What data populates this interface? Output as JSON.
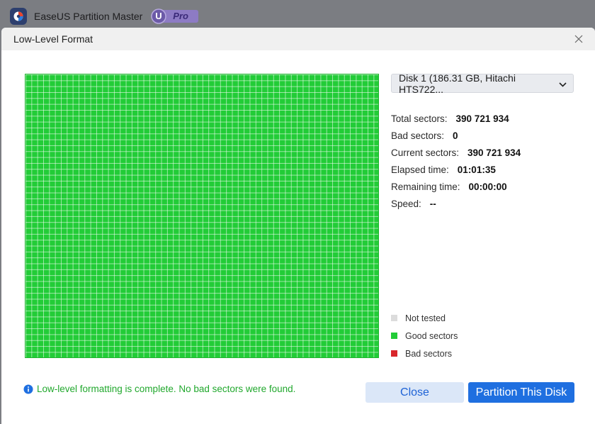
{
  "app": {
    "title": "EaseUS Partition Master",
    "badge_letter": "U",
    "badge_text": "Pro"
  },
  "dialog": {
    "title": "Low-Level Format"
  },
  "sector_grid": {
    "state": "good sectors",
    "fill_color": "#22cc37"
  },
  "disk_select": {
    "selected": "Disk 1 (186.31 GB, Hitachi HTS722..."
  },
  "stats": [
    {
      "label": "Total sectors:",
      "value": "390 721 934"
    },
    {
      "label": "Bad sectors:",
      "value": "0"
    },
    {
      "label": "Current sectors:",
      "value": "390 721 934"
    },
    {
      "label": "Elapsed time:",
      "value": "01:01:35"
    },
    {
      "label": "Remaining time:",
      "value": "00:00:00"
    },
    {
      "label": "Speed:",
      "value": "--"
    }
  ],
  "legend": [
    {
      "label": "Not tested",
      "color": "#dcdcdc"
    },
    {
      "label": "Good sectors",
      "color": "#22cc37"
    },
    {
      "label": "Bad sectors",
      "color": "#d8262b"
    }
  ],
  "status_message": "Low-level formatting is complete. No bad sectors were found.",
  "buttons": {
    "close": "Close",
    "partition": "Partition This Disk"
  },
  "colors": {
    "accent": "#1f6fe0",
    "success": "#21a82d"
  }
}
